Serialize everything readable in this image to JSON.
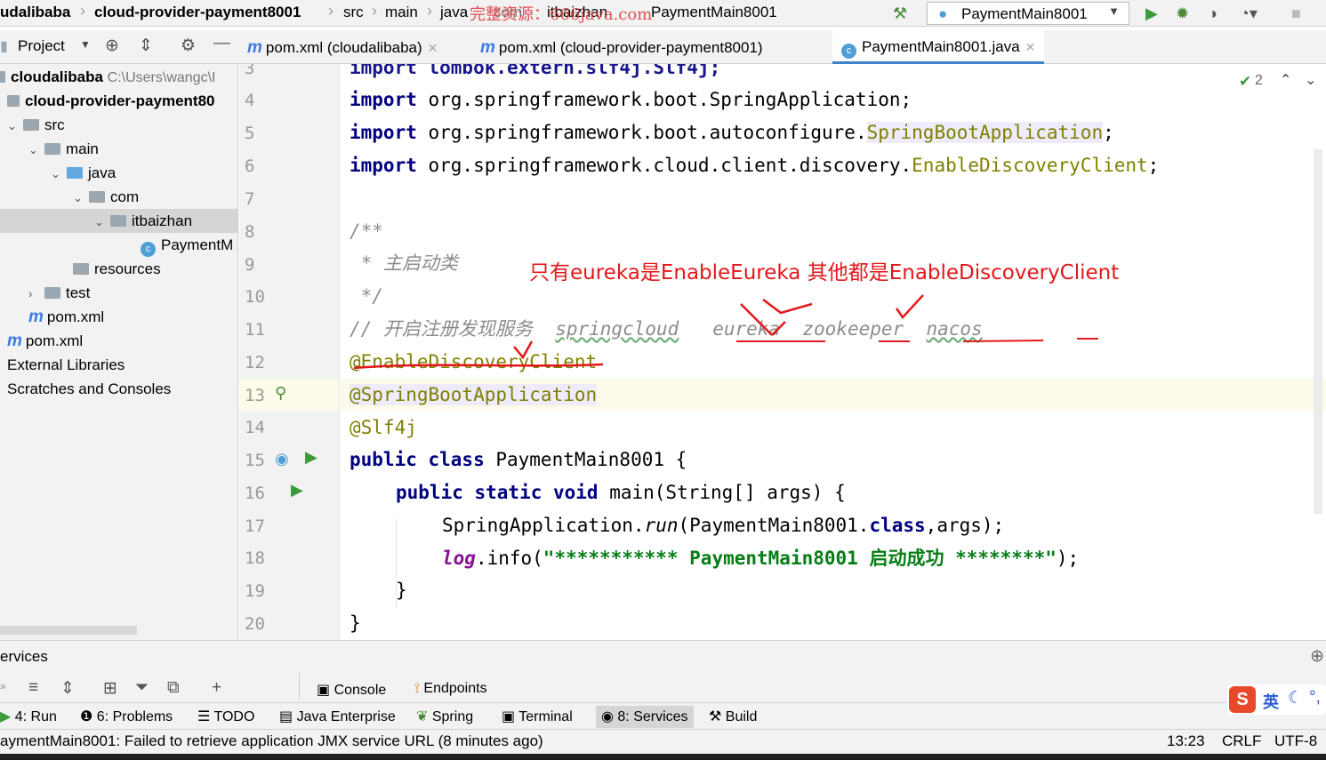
{
  "navbar": {
    "crumbs": [
      "udalibaba",
      "cloud-provider-payment8001",
      "src",
      "main",
      "java",
      "com",
      "itbaizhan",
      "PaymentMain8001"
    ],
    "watermark": "完整资源：666java.com",
    "run_config": "PaymentMain8001"
  },
  "project_panel": {
    "title": "Project",
    "tree": [
      {
        "label": "cloudalibaba",
        "hint": "C:\\Users\\wangc\\I"
      },
      {
        "label": "cloud-provider-payment80"
      },
      {
        "label": "src"
      },
      {
        "label": "main"
      },
      {
        "label": "java"
      },
      {
        "label": "com"
      },
      {
        "label": "itbaizhan"
      },
      {
        "label": "PaymentM"
      },
      {
        "label": "resources"
      },
      {
        "label": "test"
      },
      {
        "label": "pom.xml"
      },
      {
        "label": "pom.xml"
      },
      {
        "label": "External Libraries"
      },
      {
        "label": "Scratches and Consoles"
      }
    ]
  },
  "editor_tabs": [
    {
      "label": "pom.xml (cloudalibaba)"
    },
    {
      "label": "pom.xml (cloud-provider-payment8001)"
    },
    {
      "label": "PaymentMain8001.java"
    }
  ],
  "inspection_count": "2",
  "line_numbers": [
    "3",
    "4",
    "5",
    "6",
    "7",
    "8",
    "9",
    "10",
    "11",
    "12",
    "13",
    "14",
    "15",
    "16",
    "17",
    "18",
    "19",
    "20"
  ],
  "code": {
    "l3": "import lombok.extern.slf4j.Slf4j;",
    "l4_kw": "import",
    "l4_rest": " org.springframework.boot.SpringApplication;",
    "l5_kw": "import",
    "l5_rest": " org.springframework.boot.autoconfigure.",
    "l5_cls": "SpringBootApplication",
    "l5_end": ";",
    "l6_kw": "import",
    "l6_rest": " org.springframework.cloud.client.discovery.",
    "l6_cls": "EnableDiscoveryClient",
    "l6_end": ";",
    "l8": "/**",
    "l9": " * 主启动类",
    "l10": " */",
    "l11_a": "// 开启注册发现服务  ",
    "l11_b": "springcloud",
    "l11_c": "   eureka  zookeeper  ",
    "l11_d": "nacos",
    "l12": "@EnableDiscoveryClient",
    "l13": "@SpringBootApplication",
    "l14": "@Slf4j",
    "l15_kw": "public class",
    "l15_rest": " PaymentMain8001 {",
    "l16_kw": "public static void",
    "l16_rest": " main(String[] args) {",
    "l17_a": "SpringApplication.",
    "l17_b": "run",
    "l17_c": "(PaymentMain8001.",
    "l17_d": "class",
    "l17_e": ",args);",
    "l18_a": "log",
    "l18_b": ".info(",
    "l18_c": "\"*********** PaymentMain8001 启动成功 ********\"",
    "l18_d": ");",
    "l19": "}",
    "l20": "}"
  },
  "annotation_note": "只有eureka是EnableEureka 其他都是EnableDiscoveryClient",
  "services": {
    "title": "ervices",
    "console": "Console",
    "endpoints": "Endpoints"
  },
  "bottom_tabs": [
    {
      "label": "4: Run"
    },
    {
      "label": "6: Problems"
    },
    {
      "label": "TODO"
    },
    {
      "label": "Java Enterprise"
    },
    {
      "label": "Spring"
    },
    {
      "label": "Terminal"
    },
    {
      "label": "8: Services"
    },
    {
      "label": "Build"
    }
  ],
  "status": {
    "message": "aymentMain8001: Failed to retrieve application JMX service URL (8 minutes ago)",
    "position": "13:23",
    "line_sep": "CRLF",
    "encoding": "UTF-8"
  },
  "ime": {
    "lang": "英"
  },
  "colors": {
    "keyword": "#000080",
    "annotation": "#808000",
    "string": "#067d17",
    "comment": "#8c8c8c",
    "handwriting": "#e3171b",
    "accent": "#4083c9"
  }
}
